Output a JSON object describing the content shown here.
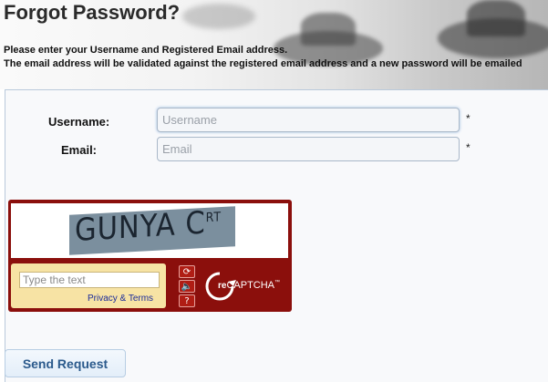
{
  "header": {
    "title": "Forgot Password?",
    "intro_line1": "Please enter your Username and Registered Email address.",
    "intro_line2": "The email address will be validated against the registered email address and a new password will be emailed"
  },
  "form": {
    "username_label": "Username:",
    "username_placeholder": "Username",
    "username_value": "",
    "email_label": "Email:",
    "email_placeholder": "Email",
    "email_value": "",
    "required_marker": "*"
  },
  "captcha": {
    "challenge_words": "GUNYA C",
    "challenge_suffix": "RT",
    "answer_placeholder": "Type the text",
    "privacy_link": "Privacy & Terms",
    "reload_icon": "refresh-icon",
    "audio_icon": "speaker-icon",
    "help_icon": "question-icon",
    "brand_prefix": "re",
    "brand": "CAPTCHA",
    "brand_tm": "™",
    "colors": {
      "frame": "#8b0f0c",
      "answer_bg": "#f7e3a4",
      "link": "#1a2a9a"
    }
  },
  "actions": {
    "send_label": "Send Request"
  }
}
